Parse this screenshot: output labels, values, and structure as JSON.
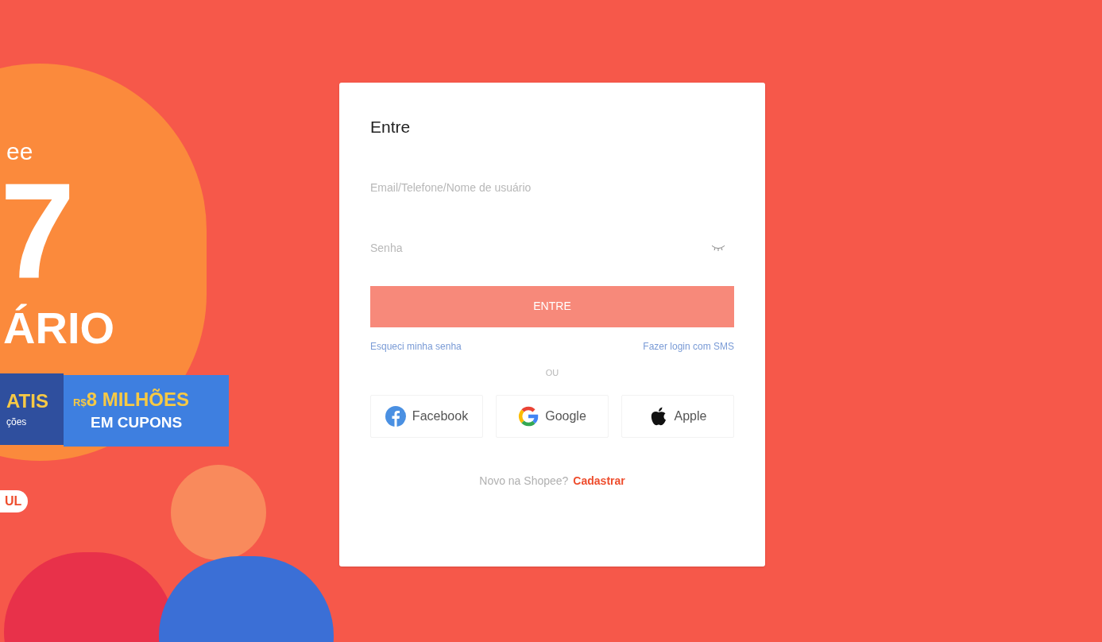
{
  "banner": {
    "brand": "ee",
    "number": "7",
    "headline": "ÁRIO",
    "ribbon_left": {
      "title": "ATIS",
      "subtitle": "ções"
    },
    "ribbon_right": {
      "currency": "R$",
      "title": "8 MILHÕES",
      "subtitle": "EM CUPONS"
    },
    "date_pill": "UL"
  },
  "login": {
    "title": "Entre",
    "username": {
      "placeholder": "Email/Telefone/Nome de usuário"
    },
    "password": {
      "placeholder": "Senha",
      "reveal": false
    },
    "submit": {
      "label": "ENTRE",
      "disabled": true
    },
    "links": [
      {
        "label": "Esqueci minha senha"
      },
      {
        "label": "Fazer login com SMS"
      }
    ],
    "divider": "OU",
    "social": [
      {
        "kind": "facebook",
        "label": "Facebook"
      },
      {
        "kind": "google",
        "label": "Google"
      },
      {
        "kind": "apple",
        "label": "Apple"
      }
    ],
    "signup": {
      "prompt": "Novo na Shopee?",
      "link": "Cadastrar"
    }
  }
}
